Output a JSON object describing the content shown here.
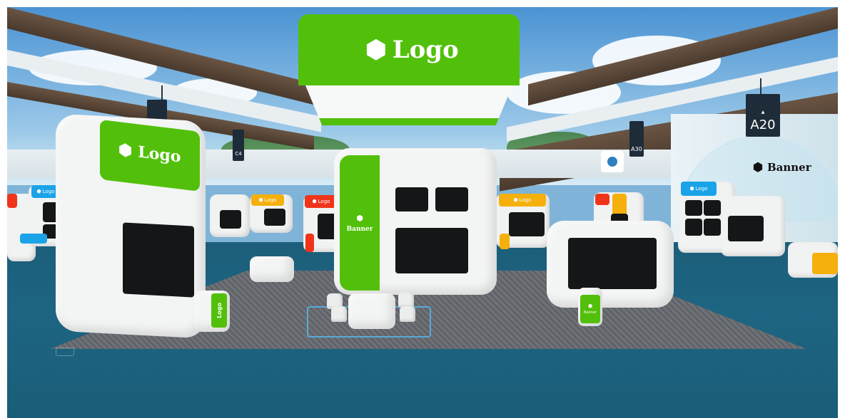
{
  "scene": {
    "hanging_sign": {
      "label": "Logo"
    },
    "left_booth": {
      "label": "Logo"
    },
    "left_kiosk": {
      "label": "Logo"
    },
    "center_booth": {
      "side_label": "Banner"
    },
    "right_kiosk": {
      "label": "Banner"
    },
    "banner_sign": {
      "label": "Banner"
    },
    "hall_markers": {
      "a20": "A20",
      "a30": "A30",
      "c4": "C4"
    },
    "back_booth_tags": [
      "Logo",
      "Logo",
      "Logo",
      "Logo",
      "Logo",
      "Logo"
    ]
  },
  "colors": {
    "brand_green": "#52c00b",
    "booth_white": "#f3f4f4",
    "floor_blue": "#1d6582",
    "carpet_gray": "#6f7378",
    "tag_orange": "#f5b00c",
    "tag_red": "#f0341a",
    "tag_blue": "#1aa3e8"
  },
  "icons": [
    "cube-icon"
  ]
}
